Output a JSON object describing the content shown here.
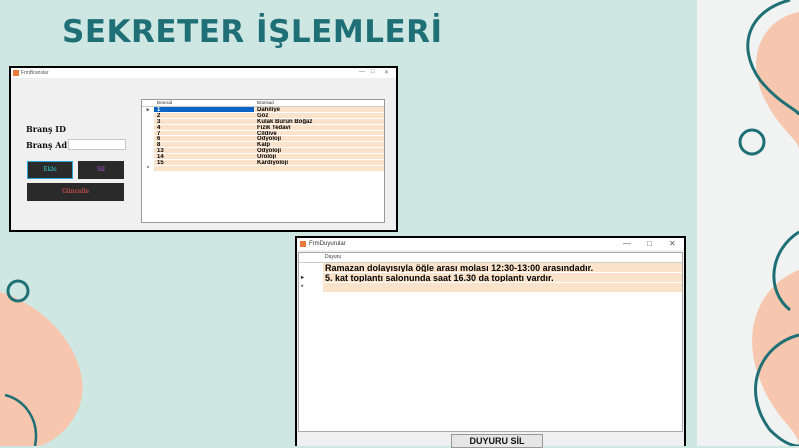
{
  "slide": {
    "title": "SEKRETER İŞLEMLERİ"
  },
  "colors": {
    "background": "#cfe7e2",
    "title": "#1f6f76",
    "peach": "#f6c7ae",
    "teal_line": "#1f6f76",
    "row_fill": "#fbe3cb",
    "selection": "#0a64c8"
  },
  "window1": {
    "title": "FrmBranslar",
    "controls": [
      "—",
      "□",
      "✕"
    ],
    "brans_id_label": "Branş ID :",
    "brans_ad_label": "Branş Ad :",
    "brans_id_value": "",
    "brans_ad_value": "",
    "ekle_label": "Ekle",
    "sil_label": "Sil",
    "guncelle_label": "Güncelle",
    "grid": {
      "col1": "Bransid",
      "col2": "Bransad",
      "rows": [
        {
          "id": "1",
          "name": "Dahiliye"
        },
        {
          "id": "2",
          "name": "Göz"
        },
        {
          "id": "3",
          "name": "Kulak Burun Boğaz"
        },
        {
          "id": "4",
          "name": "Fizik Tedavi"
        },
        {
          "id": "7",
          "name": "Cildiye"
        },
        {
          "id": "6",
          "name": "Odyoloji"
        },
        {
          "id": "8",
          "name": "Kalp"
        },
        {
          "id": "13",
          "name": "Odyoloji"
        },
        {
          "id": "14",
          "name": "Üroloji"
        },
        {
          "id": "15",
          "name": "Kardiyoloji"
        }
      ],
      "current_marker": "▸",
      "new_marker": "*"
    }
  },
  "window2": {
    "title": "FrmDuyurular",
    "controls": [
      "—",
      "□",
      "✕"
    ],
    "grid": {
      "col": "Duyuru",
      "rows": [
        "Ramazan dolayısıyla öğle arası molası 12:30-13:00 arasındadır.",
        "5. kat toplantı salonunda saat 16.30 da toplantı vardır."
      ],
      "current_marker": "▸",
      "new_marker": "*"
    },
    "delete_button_label": "DUYURU SİL"
  }
}
